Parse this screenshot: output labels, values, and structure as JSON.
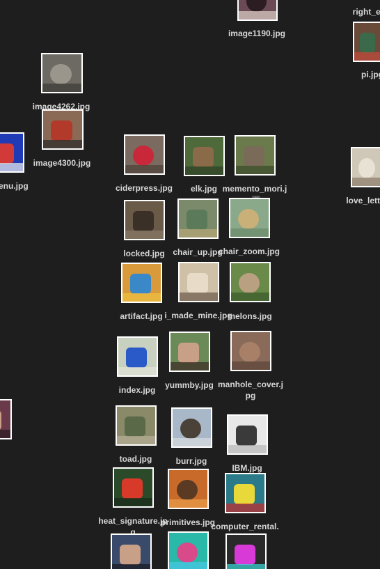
{
  "desktop": {
    "background": "#1e1e1e",
    "files": [
      {
        "id": "image1190",
        "label": "image1190.jpg",
        "colors": [
          "#6a4a55",
          "#2b1d22",
          "#e0d0c8"
        ]
      },
      {
        "id": "right-eye",
        "label": "right_ey",
        "colors": []
      },
      {
        "id": "pi",
        "label": "pi.jpg",
        "colors": [
          "#6a4b3a",
          "#3a6a4a",
          "#c44a3a"
        ]
      },
      {
        "id": "image4262",
        "label": "image4262.jpg",
        "colors": [
          "#6d6a63",
          "#9a968c",
          "#3b3a36"
        ]
      },
      {
        "id": "image4300",
        "label": "image4300.jpg",
        "colors": [
          "#8a6a55",
          "#b23a2a",
          "#2a2a2a"
        ]
      },
      {
        "id": "menu",
        "label": "menu.jpg",
        "colors": [
          "#1e3ab4",
          "#d23a3a",
          "#f0f0f0"
        ]
      },
      {
        "id": "ciderpress",
        "label": "ciderpress.jpg",
        "colors": [
          "#7a6a60",
          "#c8283a",
          "#4a4038"
        ]
      },
      {
        "id": "elk",
        "label": "elk.jpg",
        "colors": [
          "#4f6a3a",
          "#8a6a48",
          "#2e4024"
        ]
      },
      {
        "id": "memento-mori",
        "label": "memento_mori.jp",
        "tag": "g",
        "colors": [
          "#6a7a4a",
          "#7a6a58",
          "#3b4a2a"
        ]
      },
      {
        "id": "love-letter",
        "label": "love_lette",
        "colors": [
          "#cfc8b8",
          "#e8e2d4",
          "#8a7a6a"
        ]
      },
      {
        "id": "locked",
        "label": "locked.jpg",
        "colors": [
          "#6a5a48",
          "#3a3028",
          "#8a7a68"
        ]
      },
      {
        "id": "chair-up",
        "label": "chair_up.jpg",
        "colors": [
          "#7a8a6a",
          "#5a7a5a",
          "#b8a878"
        ]
      },
      {
        "id": "chair-zoom",
        "label": "chair_zoom.jpg",
        "colors": [
          "#8aa88a",
          "#c8b078",
          "#6a8a6a"
        ]
      },
      {
        "id": "artifact",
        "label": "artifact.jpg",
        "colors": [
          "#d89a3a",
          "#3a88c8",
          "#f0c040"
        ]
      },
      {
        "id": "i-made-mine",
        "label": "i_made_mine.jpg",
        "colors": [
          "#cfc0a8",
          "#e8dcc8",
          "#6a5a48"
        ]
      },
      {
        "id": "melons",
        "label": "melons.jpg",
        "colors": [
          "#6a8a4a",
          "#b8a080",
          "#3a5a2a"
        ]
      },
      {
        "id": "index",
        "label": "index.jpg",
        "colors": [
          "#c8d0c0",
          "#2a5ac8",
          "#e0e4d8"
        ]
      },
      {
        "id": "yummby",
        "label": "yummby.jpg",
        "colors": [
          "#6a8a58",
          "#c8a088",
          "#3a2a22"
        ]
      },
      {
        "id": "manhole-cover",
        "label": "manhole_cover.jpg",
        "colors": [
          "#8a6a58",
          "#a88068",
          "#5a4438"
        ]
      },
      {
        "id": "image-edge-left",
        "label": "pg",
        "colors": [
          "#6a3a4a",
          "#c8a088",
          "#2a1a22"
        ]
      },
      {
        "id": "toad",
        "label": "toad.jpg",
        "colors": [
          "#8a8a68",
          "#5a6a48",
          "#b8b098"
        ]
      },
      {
        "id": "burr",
        "label": "burr.jpg",
        "colors": [
          "#a8b8c8",
          "#4a4238",
          "#d8dce0"
        ]
      },
      {
        "id": "ibm",
        "label": "IBM.jpg",
        "colors": [
          "#e8e8e8",
          "#3a3a3a",
          "#b8b8b8"
        ]
      },
      {
        "id": "heat-signature",
        "label": "heat_signature.jpg",
        "colors": [
          "#2a4a2a",
          "#d83a2a",
          "#1a2a1a"
        ]
      },
      {
        "id": "primitives",
        "label": "primitives.jpg",
        "colors": [
          "#c86a2a",
          "#5a3a22",
          "#e8a048"
        ]
      },
      {
        "id": "computer-rental",
        "label": "computer_rental.j",
        "colors": [
          "#2a7a8a",
          "#e8d83a",
          "#c82a2a"
        ]
      },
      {
        "id": "selfie",
        "label": "",
        "colors": [
          "#3a4a6a",
          "#c8a088",
          "#1a1a22"
        ]
      },
      {
        "id": "swirl",
        "label": "",
        "colors": [
          "#2ab8a8",
          "#d84a8a",
          "#48c8e8"
        ]
      },
      {
        "id": "rainbow",
        "label": "",
        "colors": [
          "#2a2a2a",
          "#d83ad8",
          "#3ad8d8"
        ]
      }
    ]
  }
}
